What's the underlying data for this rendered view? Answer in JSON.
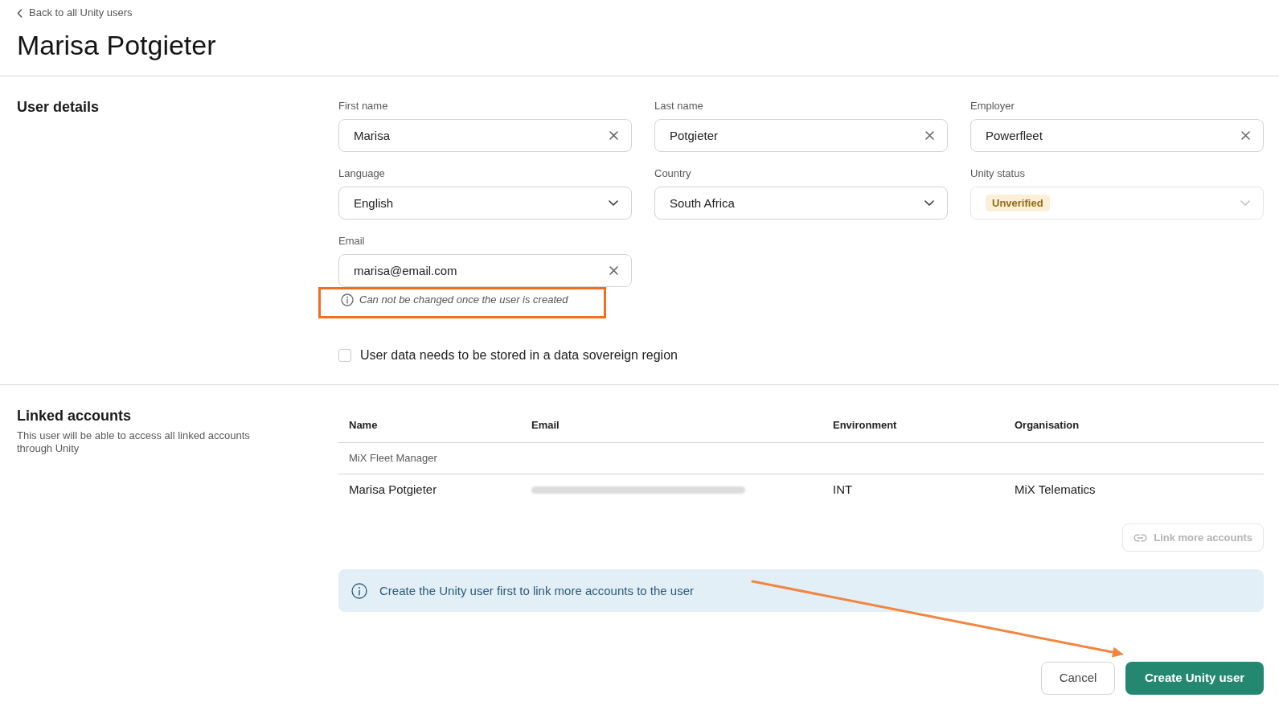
{
  "back_link": {
    "label": "Back to all Unity users"
  },
  "title": "Marisa Potgieter",
  "user_details": {
    "heading": "User details",
    "fields": [
      {
        "kind": "text",
        "label": "First name",
        "value": "Marisa",
        "disabled": false
      },
      {
        "kind": "text",
        "label": "Last name",
        "value": "Potgieter",
        "disabled": false
      },
      {
        "kind": "text",
        "label": "Employer",
        "value": "Powerfleet",
        "disabled": false
      },
      {
        "kind": "select",
        "label": "Language",
        "value": "English",
        "disabled": false
      },
      {
        "kind": "select",
        "label": "Country",
        "value": "South Africa",
        "disabled": false
      },
      {
        "kind": "status",
        "label": "Unity status",
        "value": "Unverified",
        "disabled": true
      },
      {
        "kind": "text",
        "label": "Email",
        "value": "marisa@email.com",
        "disabled": false,
        "hint": "Can not be changed once the user is created"
      }
    ],
    "checkbox": {
      "label": "User data needs to be stored in a data sovereign region",
      "checked": false
    }
  },
  "linked_accounts": {
    "heading": "Linked accounts",
    "description": "This user will be able to access all linked accounts through Unity",
    "table": {
      "columns": [
        "Name",
        "Email",
        "Environment",
        "Organisation"
      ],
      "groups": [
        {
          "label": "MiX Fleet Manager",
          "rows": [
            {
              "name": "Marisa Potgieter",
              "email_blurred": true,
              "environment": "INT",
              "organisation": "MiX Telematics"
            }
          ]
        }
      ]
    },
    "link_button": {
      "label": "Link more accounts",
      "disabled": true
    },
    "info": "Create the Unity user first to link more accounts to the user"
  },
  "actions": [
    {
      "kind": "secondary",
      "label": "Cancel"
    },
    {
      "kind": "primary",
      "label": "Create Unity user"
    }
  ],
  "annotations": {
    "highlight_frame": true,
    "arrow": true
  }
}
